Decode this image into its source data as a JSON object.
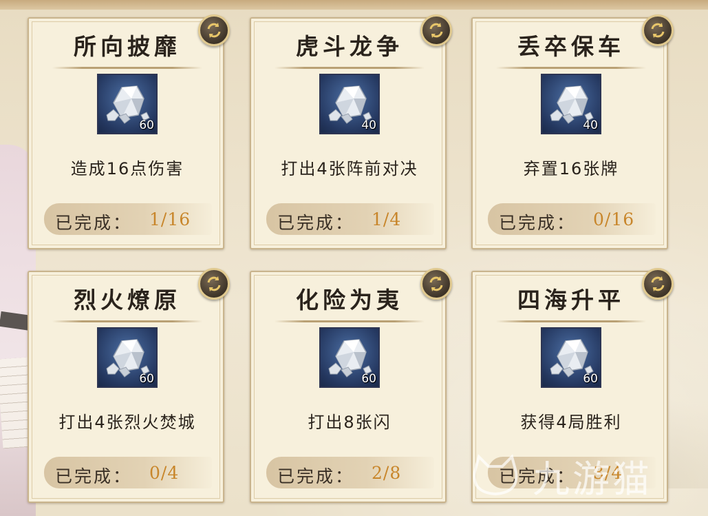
{
  "cards": [
    {
      "title": "所向披靡",
      "reward_count": "60",
      "description": "造成16点伤害",
      "progress_label": "已完成：",
      "progress_value": "1/16"
    },
    {
      "title": "虎斗龙争",
      "reward_count": "40",
      "description": "打出4张阵前对决",
      "progress_label": "已完成：",
      "progress_value": "1/4"
    },
    {
      "title": "丢卒保车",
      "reward_count": "40",
      "description": "弃置16张牌",
      "progress_label": "已完成：",
      "progress_value": "0/16"
    },
    {
      "title": "烈火燎原",
      "reward_count": "60",
      "description": "打出4张烈火焚城",
      "progress_label": "已完成：",
      "progress_value": "0/4"
    },
    {
      "title": "化险为夷",
      "reward_count": "60",
      "description": "打出8张闪",
      "progress_label": "已完成：",
      "progress_value": "2/8"
    },
    {
      "title": "四海升平",
      "reward_count": "60",
      "description": "获得4局胜利",
      "progress_label": "已完成：",
      "progress_value": "3/4"
    }
  ],
  "icons": {
    "refresh": "refresh-icon",
    "reward_item": "crystal-ore-icon"
  },
  "watermark": "九游猫",
  "colors": {
    "progress_value": "#c8862b",
    "card_bg": "#f7f0dc",
    "item_bg": "#24375f"
  }
}
